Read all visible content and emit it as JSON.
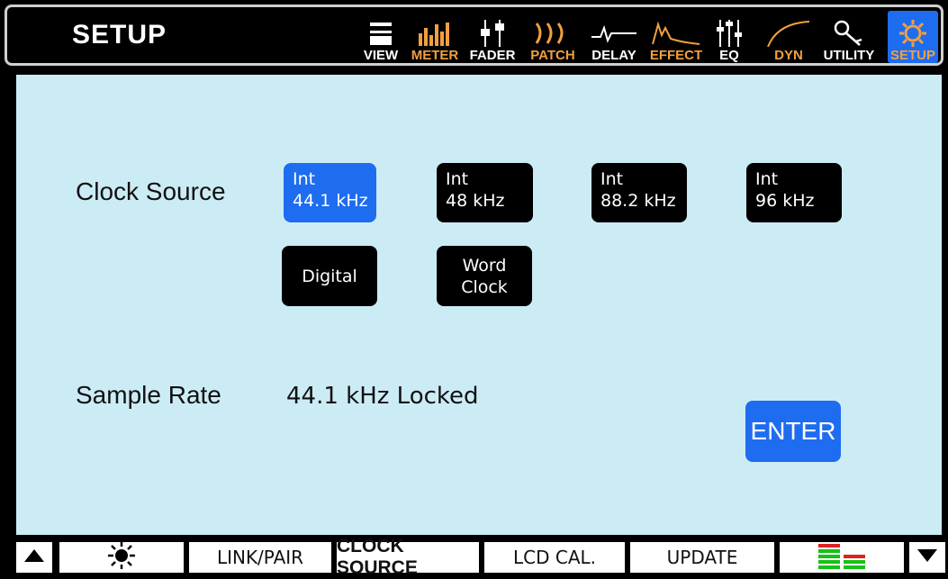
{
  "header": {
    "title": "SETUP",
    "nav": [
      {
        "label": "VIEW",
        "icon": "view-icon",
        "color": "#ffffff"
      },
      {
        "label": "METER",
        "icon": "meter-icon",
        "color": "#f0a040"
      },
      {
        "label": "FADER",
        "icon": "fader-icon",
        "color": "#ffffff"
      },
      {
        "label": "PATCH",
        "icon": "patch-icon",
        "color": "#f0a040"
      },
      {
        "label": "DELAY",
        "icon": "delay-icon",
        "color": "#ffffff"
      },
      {
        "label": "EFFECT",
        "icon": "effect-icon",
        "color": "#f0a040"
      },
      {
        "label": "EQ",
        "icon": "eq-icon",
        "color": "#ffffff"
      },
      {
        "label": "DYN",
        "icon": "dyn-icon",
        "color": "#f0a040"
      },
      {
        "label": "UTILITY",
        "icon": "utility-icon",
        "color": "#ffffff"
      },
      {
        "label": "SETUP",
        "icon": "setup-gear-icon",
        "color": "#f0a040",
        "active": true
      }
    ]
  },
  "main": {
    "clock_source_label": "Clock Source",
    "clock_options": [
      {
        "line1": "Int",
        "line2": "44.1 kHz",
        "selected": true
      },
      {
        "line1": "Int",
        "line2": "48 kHz",
        "selected": false
      },
      {
        "line1": "Int",
        "line2": "88.2 kHz",
        "selected": false
      },
      {
        "line1": "Int",
        "line2": "96 kHz",
        "selected": false
      },
      {
        "line1": "Digital",
        "line2": "",
        "selected": false
      },
      {
        "line1": "Word",
        "line2": "Clock",
        "selected": false
      }
    ],
    "sample_rate_label": "Sample Rate",
    "sample_rate_value": "44.1 kHz Locked",
    "enter_label": "ENTER"
  },
  "footer": {
    "tabs": [
      {
        "label": "LINK/PAIR",
        "active": false
      },
      {
        "label": "CLOCK SOURCE",
        "active": true
      },
      {
        "label": "LCD CAL.",
        "active": false
      },
      {
        "label": "UPDATE",
        "active": false
      }
    ],
    "icons": [
      "up-arrow-icon",
      "brightness-icon",
      "level-meter-icon",
      "down-arrow-icon"
    ]
  },
  "colors": {
    "accent": "#1e6cf0",
    "panel": "#ccecf5",
    "orange": "#f0a040"
  }
}
